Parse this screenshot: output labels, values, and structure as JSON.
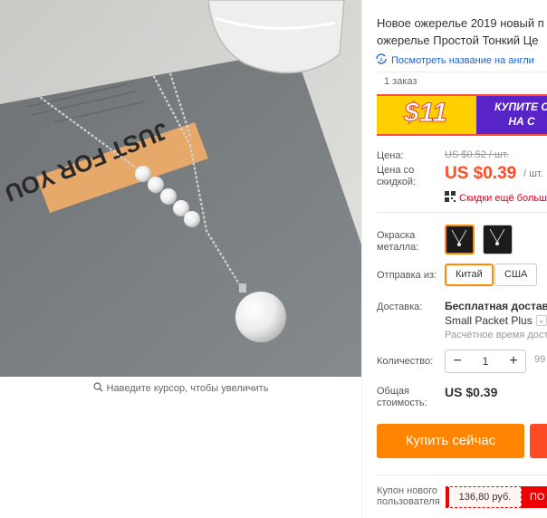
{
  "product": {
    "title": "Новое ожерелье 2019 новый п ожерелье Простой Тонкий Це",
    "title_line1": "Новое ожерелье 2019 новый п",
    "title_line2": "ожерелье Простой Тонкий Це",
    "translate_link": "Посмотреть название на англи",
    "orders": "1 заказ",
    "zoom_hint": "Наведите курсор, чтобы увеличить",
    "image_card_text": "JUST FOR YOU"
  },
  "banner": {
    "amount": "$11",
    "promo_line1": "КУПИТЕ С",
    "promo_line2": "НА С"
  },
  "price": {
    "label": "Цена:",
    "old": "US $0.52 / шт.",
    "discount_label": "Цена со скидкой:",
    "new": "US $0.39",
    "per": "/ шт.",
    "more_discounts": "Скидки ещё больш"
  },
  "options": {
    "color_label": "Окраска металла:",
    "ship_from_label": "Отправка из:",
    "ship_from": [
      "Китай",
      "США"
    ],
    "ship_from_selected": "Китай"
  },
  "shipping": {
    "label": "Доставка:",
    "title": "Бесплатная доставка",
    "method": "Small Packet Plus",
    "time": "Расчётное время дост"
  },
  "quantity": {
    "label": "Количество:",
    "value": "1",
    "minus": "−",
    "plus": "+",
    "extra": "99"
  },
  "total": {
    "label": "Общая стоимость:",
    "value": "US $0.39"
  },
  "actions": {
    "buy_now": "Купить сейчас"
  },
  "coupon": {
    "label": "Купон нового пользователя",
    "value": "136,80 руб.",
    "get": "ПО"
  },
  "colors": {
    "accent": "#ff8400",
    "price": "#ff4b24",
    "link": "#1a63d2"
  }
}
